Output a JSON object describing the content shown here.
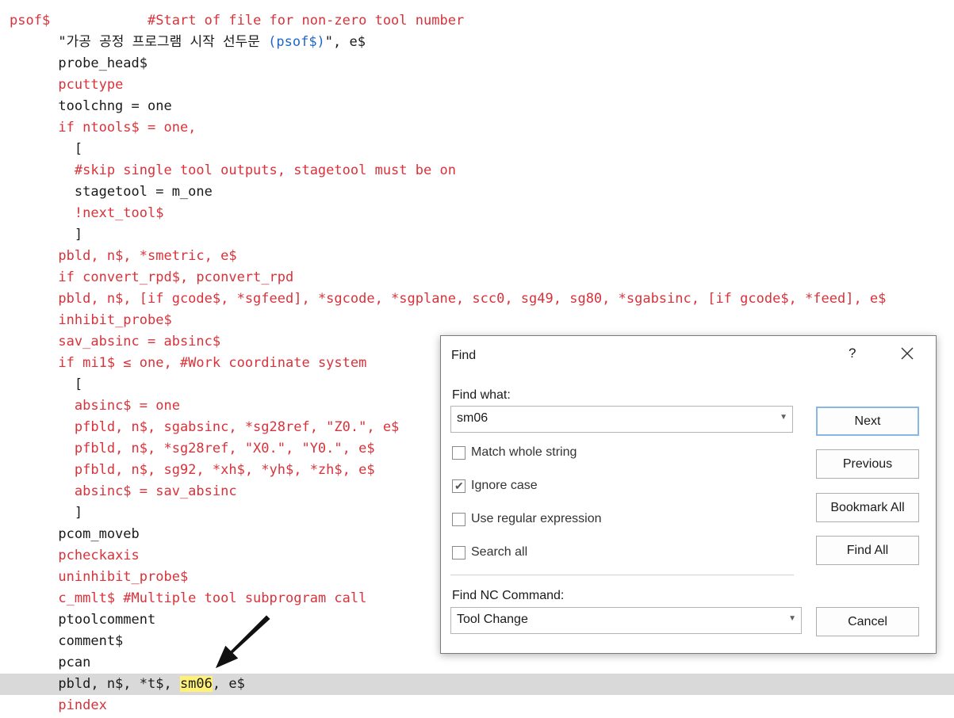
{
  "code": {
    "lines": [
      [
        {
          "t": "psof$",
          "c": "#d9323a"
        },
        {
          "t": "            ",
          "c": "#1a1a1a"
        },
        {
          "t": "#Start of file for non-zero tool number",
          "c": "#d9323a"
        }
      ],
      [
        {
          "t": "      \"가공 공정 프로그램 시작 선두문 ",
          "c": "#1a1a1a"
        },
        {
          "t": "(psof$)",
          "c": "#1e67c8"
        },
        {
          "t": "\", e$",
          "c": "#1a1a1a"
        }
      ],
      [
        {
          "t": "      probe_head$",
          "c": "#1a1a1a"
        }
      ],
      [
        {
          "t": "      ",
          "c": "#1a1a1a"
        },
        {
          "t": "pcuttype",
          "c": "#d9323a"
        }
      ],
      [
        {
          "t": "      toolchng = one",
          "c": "#1a1a1a"
        }
      ],
      [
        {
          "t": "      ",
          "c": "#1a1a1a"
        },
        {
          "t": "if ntools$ = one,",
          "c": "#d9323a"
        }
      ],
      [
        {
          "t": "        [",
          "c": "#1a1a1a"
        }
      ],
      [
        {
          "t": "        ",
          "c": "#1a1a1a"
        },
        {
          "t": "#skip single tool outputs, stagetool must be on",
          "c": "#d9323a"
        }
      ],
      [
        {
          "t": "        stagetool = m_one",
          "c": "#1a1a1a"
        }
      ],
      [
        {
          "t": "        ",
          "c": "#1a1a1a"
        },
        {
          "t": "!next_tool$",
          "c": "#d9323a"
        }
      ],
      [
        {
          "t": "        ]",
          "c": "#1a1a1a"
        }
      ],
      [
        {
          "t": "      ",
          "c": "#1a1a1a"
        },
        {
          "t": "pbld, n$, *smetric, e$",
          "c": "#d9323a"
        }
      ],
      [
        {
          "t": "      ",
          "c": "#1a1a1a"
        },
        {
          "t": "if convert_rpd$, pconvert_rpd",
          "c": "#d9323a"
        }
      ],
      [
        {
          "t": "      ",
          "c": "#1a1a1a"
        },
        {
          "t": "pbld, n$, [if gcode$, *sgfeed], *sgcode, *sgplane, scc0, sg49, sg80, *sgabsinc, [if gcode$, *feed], e$",
          "c": "#d9323a"
        }
      ],
      [
        {
          "t": "      ",
          "c": "#1a1a1a"
        },
        {
          "t": "inhibit_probe$",
          "c": "#d9323a"
        }
      ],
      [
        {
          "t": "      ",
          "c": "#1a1a1a"
        },
        {
          "t": "sav_absinc = absinc$",
          "c": "#d9323a"
        }
      ],
      [
        {
          "t": "      ",
          "c": "#1a1a1a"
        },
        {
          "t": "if mi1$ ≤ one, #Work coordinate system",
          "c": "#d9323a"
        }
      ],
      [
        {
          "t": "        [",
          "c": "#1a1a1a"
        }
      ],
      [
        {
          "t": "        ",
          "c": "#1a1a1a"
        },
        {
          "t": "absinc$ = one",
          "c": "#d9323a"
        }
      ],
      [
        {
          "t": "        ",
          "c": "#1a1a1a"
        },
        {
          "t": "pfbld, n$, sgabsinc, *sg28ref, \"Z0.\", e$",
          "c": "#d9323a"
        }
      ],
      [
        {
          "t": "        ",
          "c": "#1a1a1a"
        },
        {
          "t": "pfbld, n$, *sg28ref, \"X0.\", \"Y0.\", e$",
          "c": "#d9323a"
        }
      ],
      [
        {
          "t": "        ",
          "c": "#1a1a1a"
        },
        {
          "t": "pfbld, n$, sg92, *xh$, *yh$, *zh$, e$",
          "c": "#d9323a"
        }
      ],
      [
        {
          "t": "        ",
          "c": "#1a1a1a"
        },
        {
          "t": "absinc$ = sav_absinc",
          "c": "#d9323a"
        }
      ],
      [
        {
          "t": "        ]",
          "c": "#1a1a1a"
        }
      ],
      [
        {
          "t": "      pcom_moveb",
          "c": "#1a1a1a"
        }
      ],
      [
        {
          "t": "      ",
          "c": "#1a1a1a"
        },
        {
          "t": "pcheckaxis",
          "c": "#d9323a"
        }
      ],
      [
        {
          "t": "      ",
          "c": "#1a1a1a"
        },
        {
          "t": "uninhibit_probe$",
          "c": "#d9323a"
        }
      ],
      [
        {
          "t": "      ",
          "c": "#1a1a1a"
        },
        {
          "t": "c_mmlt$ #Multiple tool subprogram call",
          "c": "#d9323a"
        }
      ],
      [
        {
          "t": "      ptoolcomment",
          "c": "#1a1a1a"
        }
      ],
      [
        {
          "t": "      comment$",
          "c": "#1a1a1a"
        }
      ],
      [
        {
          "t": "      pcan",
          "c": "#1a1a1a"
        }
      ],
      [
        {
          "t": "      pbld, n$, *t$, ",
          "c": "#1a1a1a"
        },
        {
          "t": "sm06",
          "c": "#1a1a1a",
          "hl": true
        },
        {
          "t": ", e$",
          "c": "#1a1a1a"
        }
      ],
      [
        {
          "t": "      ",
          "c": "#1a1a1a"
        },
        {
          "t": "pindex",
          "c": "#d9323a"
        }
      ]
    ],
    "current_line": 31,
    "highlight_color": "#fff176"
  },
  "find_dialog": {
    "title": "Find",
    "help_label": "?",
    "find_what_label": "Find what:",
    "find_what_value": "sm06",
    "options": [
      {
        "label": "Match whole string",
        "checked": false
      },
      {
        "label": "Ignore case",
        "checked": true
      },
      {
        "label": "Use regular expression",
        "checked": false
      },
      {
        "label": "Search all",
        "checked": false
      }
    ],
    "nc_command_label": "Find NC Command:",
    "nc_command_value": "Tool Change",
    "buttons": {
      "next": "Next",
      "previous": "Previous",
      "bookmark_all": "Bookmark All",
      "find_all": "Find All",
      "cancel": "Cancel"
    }
  }
}
